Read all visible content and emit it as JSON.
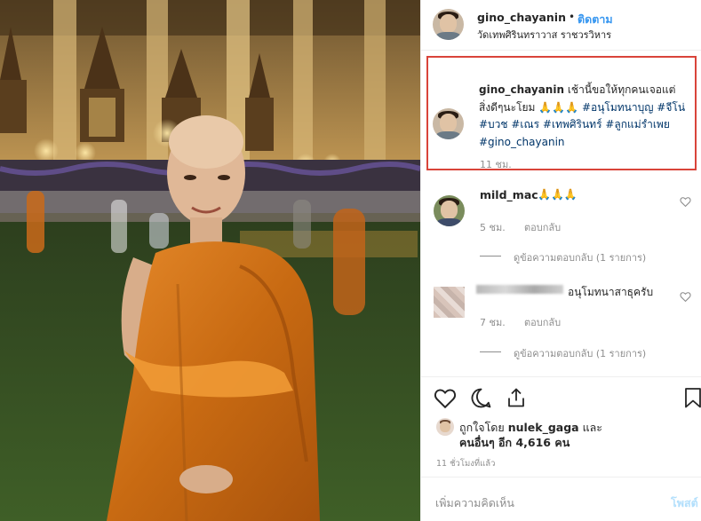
{
  "post": {
    "username": "gino_chayanin",
    "dot": "•",
    "follow_label": "ติดตาม",
    "location": "วัดเทพศิรินทราวาส ราชวรวิหาร"
  },
  "caption": {
    "username": "gino_chayanin",
    "text1": "เช้านี้ขอให้ทุกคนเจอแต่สิ่งดีๆนะโยม",
    "emoji": "🙏🙏🙏",
    "tags_line": "#อนุโมทนาบุญ #จีโน่ #บวช #เณร #เทพศิรินทร์ #ลูกแม่รำเพย #gino_chayanin",
    "time": "11 ชม."
  },
  "comments": [
    {
      "username": "mild_mac",
      "text": "🙏🙏🙏",
      "time": "5 ชม.",
      "reply_label": "ตอบกลับ",
      "view_replies": "ดูข้อความตอบกลับ (1 รายการ)"
    },
    {
      "text": "อนุโมทนาสาธุครับ",
      "time": "7 ชม.",
      "reply_label": "ตอบกลับ",
      "view_replies": "ดูข้อความตอบกลับ (1 รายการ)"
    }
  ],
  "likes": {
    "prefix": "ถูกใจโดย",
    "liker": "nulek_gaga",
    "and": "และ",
    "others": "คนอื่นๆ อีก 4,616 คน"
  },
  "posted_ago": "11 ชั่วโมงที่แล้ว",
  "add_comment_placeholder": "เพิ่มความคิดเห็น",
  "post_button": "โพสต์",
  "icons": [
    "heart-icon",
    "comment-icon",
    "share-icon",
    "bookmark-icon"
  ],
  "colors": {
    "link": "#3897f0",
    "highlight_box": "#d9443a",
    "robe": "#d4761c"
  }
}
